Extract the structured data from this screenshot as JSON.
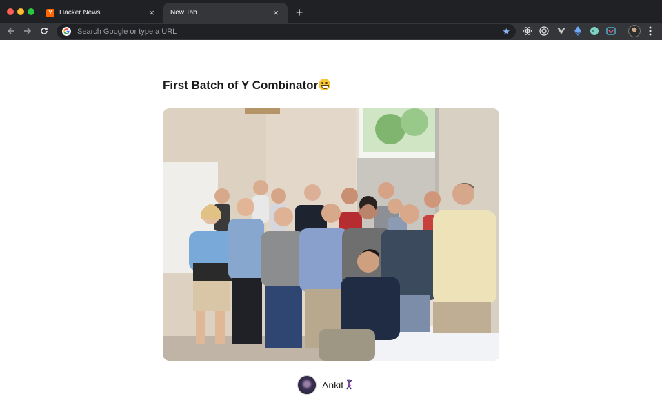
{
  "browser": {
    "tabs": [
      {
        "title": "Hacker News",
        "favicon": "Y"
      },
      {
        "title": "New Tab"
      }
    ],
    "tab_close": "×",
    "new_tab": "+",
    "omnibox": {
      "placeholder": "Search Google or type a URL"
    }
  },
  "page": {
    "title": "First Batch of Y Combinator",
    "title_emoji": "grinning-face-emoji",
    "photo_alt": "First Batch of Y Combinator",
    "author": {
      "name": "Ankit",
      "emoji": "person-dancing-icon"
    }
  },
  "colors": {
    "page_bg": "#ffffff",
    "chrome_dark": "#202124",
    "chrome_toolbar": "#35363a",
    "hn_orange": "#ff6600",
    "star_blue": "#8ab4f8"
  }
}
